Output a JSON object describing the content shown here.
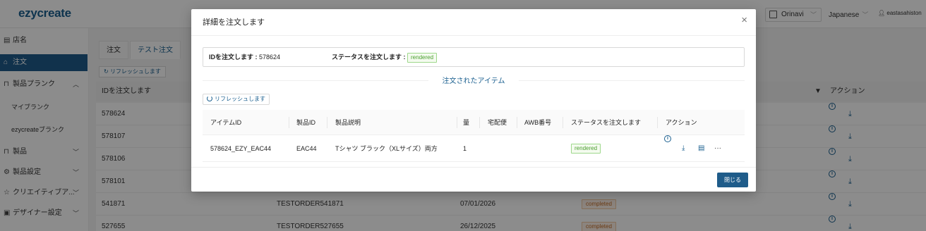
{
  "app": {
    "logo": "ezycreate"
  },
  "topbar": {
    "store": "Orinavi",
    "language": "Japanese",
    "user": "eastasahiston"
  },
  "sidebar": {
    "items": [
      {
        "label": "店名",
        "icon": "store-icon"
      },
      {
        "label": "注文",
        "icon": "bag-icon",
        "active": true
      },
      {
        "label": "製品プランク",
        "icon": "cart-icon",
        "expanded": true
      },
      {
        "label": "マイブランク",
        "sub": true
      },
      {
        "label": "ezycreateブランク",
        "sub": true
      },
      {
        "label": "製品",
        "icon": "cart-icon"
      },
      {
        "label": "製品設定",
        "icon": "gear-icon"
      },
      {
        "label": "クリエイティブア...",
        "icon": "star-icon"
      },
      {
        "label": "デザイナー設定",
        "icon": "picture-icon"
      }
    ]
  },
  "main": {
    "tabs": [
      {
        "label": "注文"
      },
      {
        "label": "テスト注文",
        "active": true
      }
    ],
    "refresh_label": "リフレッシュします",
    "table": {
      "col_id": "IDを注文します",
      "col_actions": "アクション",
      "rows": [
        {
          "id": "578624"
        },
        {
          "id": "578107"
        },
        {
          "id": "578106"
        },
        {
          "id": "578101"
        },
        {
          "id": "541871",
          "order": "TESTORDER541871",
          "date": "07/01/2026",
          "status": "completed"
        },
        {
          "id": "527655",
          "order": "TESTORDER527655",
          "date": "26/12/2025",
          "status": "completed"
        }
      ]
    }
  },
  "modal": {
    "title": "詳細を注文します",
    "summary": {
      "order_id_label": "IDを注文します :",
      "order_id": "578624",
      "status_label": "ステータスを注文します :",
      "status": "rendered"
    },
    "section_title": "注文されたアイテム",
    "refresh_label": "リフレッシュします",
    "columns": {
      "item_id": "アイテムID",
      "product_id": "製品ID",
      "description": "製品説明",
      "qty": "量",
      "courier": "宅配便",
      "awb": "AWB番号",
      "status": "ステータスを注文します",
      "actions": "アクション"
    },
    "items": [
      {
        "item_id": "578624_EZY_EAC44",
        "product_id": "EAC44",
        "description": "Tシャツ ブラック（XLサイズ）両方",
        "qty": "1",
        "courier": "",
        "awb": "",
        "status": "rendered"
      }
    ],
    "close_label": "閉じる"
  },
  "colors": {
    "primary": "#1f5c8a",
    "success": "#4a9e2f",
    "warning": "#c26a23"
  }
}
